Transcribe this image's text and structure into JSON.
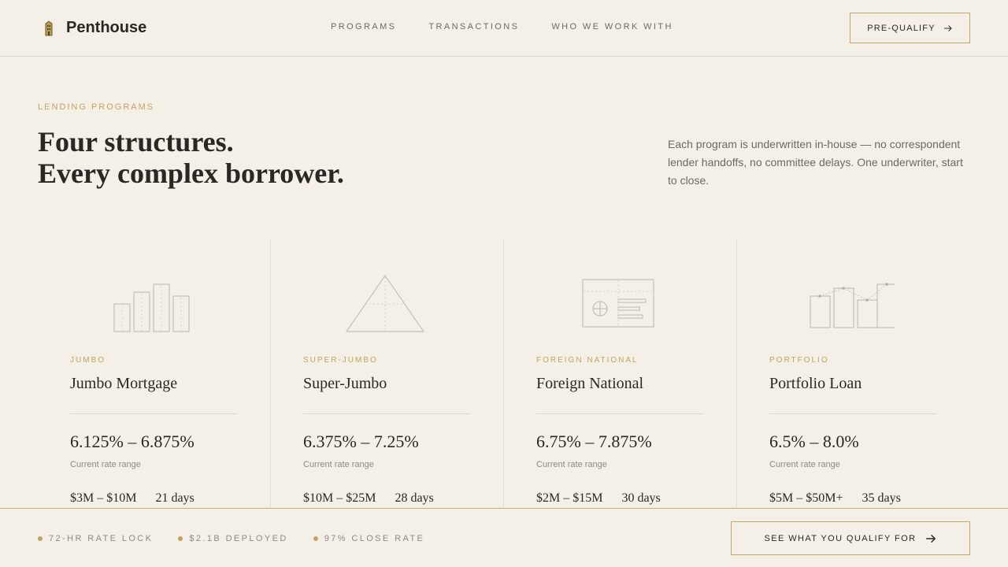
{
  "header": {
    "brand": "Penthouse",
    "nav": [
      "PROGRAMS",
      "TRANSACTIONS",
      "WHO WE WORK WITH"
    ],
    "cta": "PRE-QUALIFY"
  },
  "hero": {
    "eyebrow": "LENDING PROGRAMS",
    "headline_line1": "Four structures.",
    "headline_line2": "Every complex borrower.",
    "intro": "Each program is underwritten in-house — no correspondent lender handoffs, no committee delays. One underwriter, start to close."
  },
  "programs": [
    {
      "tag": "JUMBO",
      "title": "Jumbo Mortgage",
      "rate": "6.125% – 6.875%",
      "rate_label": "Current rate range",
      "amount": "$3M – $10M",
      "days": "21 days",
      "icon": "bar-chart-icon"
    },
    {
      "tag": "SUPER-JUMBO",
      "title": "Super-Jumbo",
      "rate": "6.375% – 7.25%",
      "rate_label": "Current rate range",
      "amount": "$10M – $25M",
      "days": "28 days",
      "icon": "triangle-icon"
    },
    {
      "tag": "FOREIGN NATIONAL",
      "title": "Foreign National",
      "rate": "6.75% – 7.875%",
      "rate_label": "Current rate range",
      "amount": "$2M – $15M",
      "days": "30 days",
      "icon": "passport-card-icon"
    },
    {
      "tag": "PORTFOLIO",
      "title": "Portfolio Loan",
      "rate": "6.5% – 8.0%",
      "rate_label": "Current rate range",
      "amount": "$5M – $50M+",
      "days": "35 days",
      "icon": "portfolio-chart-icon"
    }
  ],
  "footer": {
    "stats": [
      "72-HR RATE LOCK",
      "$2.1B DEPLOYED",
      "97% CLOSE RATE"
    ],
    "cta": "SEE WHAT YOU QUALIFY FOR"
  },
  "colors": {
    "background": "#f4efe7",
    "accent": "#c2a45e",
    "text": "#2a2824"
  }
}
